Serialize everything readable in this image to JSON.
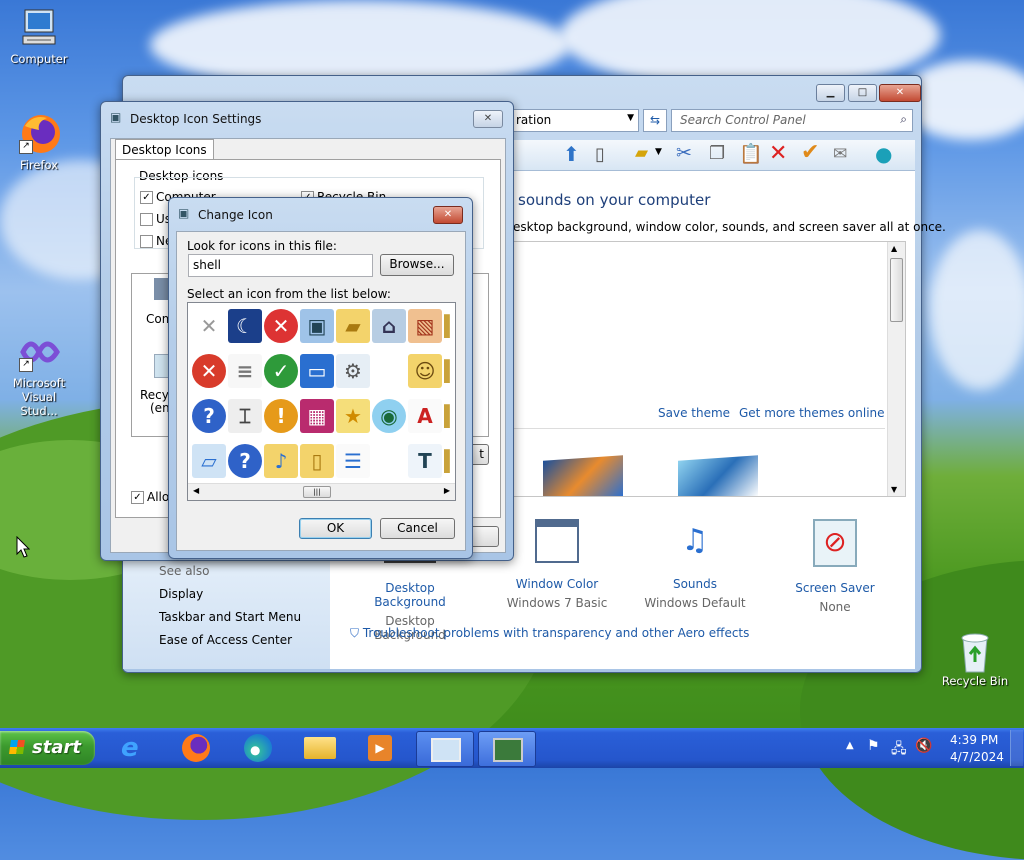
{
  "desktop": {
    "icons": [
      {
        "label": "Computer",
        "icon": "computer-icon"
      },
      {
        "label": "Firefox",
        "icon": "firefox-icon"
      },
      {
        "label": "Microsoft Visual Stud...",
        "icon": "visual-studio-icon"
      },
      {
        "label": "Recycle Bin",
        "icon": "recycle-bin-icon"
      }
    ]
  },
  "personalization": {
    "address_text": "ration",
    "search_placeholder": "Search Control Panel",
    "heading": "sounds on your computer",
    "subheading": "esktop background, window color, sounds, and screen saver all at once.",
    "save_theme": "Save theme",
    "more_themes": "Get more themes online",
    "see_also": "See also",
    "links": [
      "Display",
      "Taskbar and Start Menu",
      "Ease of Access Center"
    ],
    "items": [
      {
        "title": "Desktop Background",
        "value": "Desktop Background",
        "icon": "desktop-background-icon"
      },
      {
        "title": "Window Color",
        "value": "Windows 7 Basic",
        "icon": "window-color-icon"
      },
      {
        "title": "Sounds",
        "value": "Windows Default",
        "icon": "sounds-icon"
      },
      {
        "title": "Screen Saver",
        "value": "None",
        "icon": "screen-saver-icon"
      }
    ],
    "troubleshoot": "Troubleshoot problems with transparency and other Aero effects"
  },
  "dis": {
    "title": "Desktop Icon Settings",
    "tab": "Desktop Icons",
    "group": "Desktop icons",
    "checks": [
      {
        "label": "Computer",
        "checked": true
      },
      {
        "label": "Use",
        "checked": false
      },
      {
        "label": "Ne",
        "checked": false
      },
      {
        "label": "Recycle Bin",
        "checked": true
      }
    ],
    "tile1": "Comp",
    "tile2a": "Recyc",
    "tile2b": "(emp",
    "allow": "Allow",
    "partial_btn": "t"
  },
  "ci": {
    "title": "Change Icon",
    "look_label": "Look for icons in this file:",
    "file_value": "shell",
    "browse": "Browse...",
    "select_label": "Select an icon from the list below:",
    "ok": "OK",
    "cancel": "Cancel",
    "icons": [
      "x-glyph-icon",
      "monitor-moon-icon",
      "shield-x-icon",
      "computers-icon",
      "folder-icon",
      "network-computer-icon",
      "photo-frame-icon",
      "partial-icon",
      "error-icon",
      "document-icon",
      "shield-check-icon",
      "monitor-icon",
      "settings-list-icon",
      "blank-icon",
      "user-folder-icon",
      "partial-icon",
      "help-icon",
      "projector-icon",
      "shield-warning-icon",
      "media-icon",
      "star-folder-icon",
      "globe-icon",
      "font-a-icon",
      "partial-icon",
      "window-icon",
      "shield-help-icon",
      "music-folder-icon",
      "folder-open-icon",
      "list-icon",
      "blank-icon",
      "font-t-icon",
      "partial-icon"
    ]
  },
  "taskbar": {
    "start": "start",
    "time": "4:39 PM",
    "date": "4/7/2024"
  },
  "colors": {
    "accent": "#1e5aa8",
    "taskbar": "#2556cc",
    "start": "#3c9a2e"
  }
}
